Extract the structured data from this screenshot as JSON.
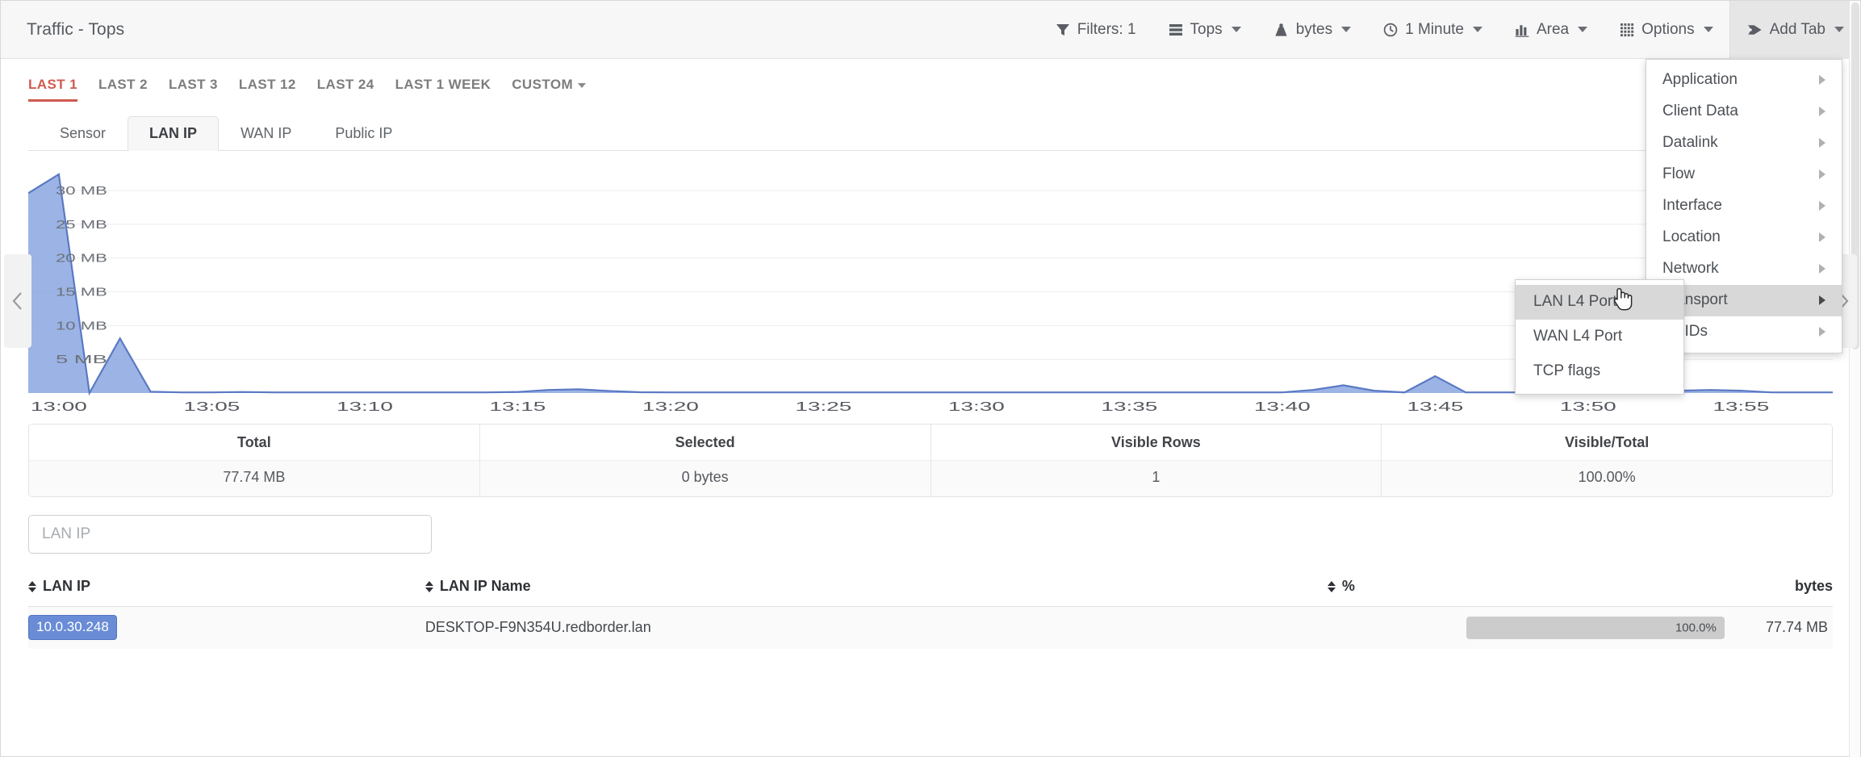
{
  "header": {
    "title": "Traffic - Tops",
    "tools": [
      {
        "id": "filters",
        "icon": "filter-icon",
        "label": "Filters: 1",
        "caret": false
      },
      {
        "id": "tops",
        "icon": "list-icon",
        "label": "Tops",
        "caret": true
      },
      {
        "id": "bytes",
        "icon": "weight-icon",
        "label": "bytes",
        "caret": true
      },
      {
        "id": "interval",
        "icon": "clock-icon",
        "label": "1 Minute",
        "caret": true
      },
      {
        "id": "charttype",
        "icon": "bar-chart-icon",
        "label": "Area",
        "caret": true
      },
      {
        "id": "options",
        "icon": "grid-icon",
        "label": "Options",
        "caret": true
      },
      {
        "id": "addtab",
        "icon": "tag-icon",
        "label": "Add Tab",
        "caret": true,
        "active": true
      }
    ]
  },
  "periods": [
    {
      "label": "LAST 1",
      "selected": true
    },
    {
      "label": "LAST 2",
      "selected": false
    },
    {
      "label": "LAST 3",
      "selected": false
    },
    {
      "label": "LAST 12",
      "selected": false
    },
    {
      "label": "LAST 24",
      "selected": false
    },
    {
      "label": "LAST 1 WEEK",
      "selected": false
    },
    {
      "label": "CUSTOM",
      "selected": false,
      "caret": true
    }
  ],
  "subtabs": [
    {
      "label": "Sensor",
      "selected": false
    },
    {
      "label": "LAN IP",
      "selected": true
    },
    {
      "label": "WAN IP",
      "selected": false
    },
    {
      "label": "Public IP",
      "selected": false
    }
  ],
  "chart_data": {
    "type": "area",
    "title": "",
    "xlabel": "",
    "ylabel": "",
    "series_name": "10.0.30.248",
    "color": "#8aa7e0",
    "line_color": "#5b79c4",
    "grid": true,
    "legend": "none",
    "ylim": [
      0,
      33
    ],
    "ytick_labels": [
      "5 MB",
      "10 MB",
      "15 MB",
      "20 MB",
      "25 MB",
      "30 MB"
    ],
    "ytick_values": [
      5,
      10,
      15,
      20,
      25,
      30
    ],
    "xtick_labels": [
      "13:00",
      "13:05",
      "13:10",
      "13:15",
      "13:20",
      "13:25",
      "13:30",
      "13:35",
      "13:40",
      "13:45",
      "13:50",
      "13:55"
    ],
    "x": [
      "12:59",
      "13:00",
      "13:01",
      "13:02",
      "13:03",
      "13:04",
      "13:05",
      "13:06",
      "13:07",
      "13:08",
      "13:09",
      "13:10",
      "13:11",
      "13:12",
      "13:13",
      "13:14",
      "13:15",
      "13:16",
      "13:17",
      "13:18",
      "13:19",
      "13:20",
      "13:21",
      "13:22",
      "13:23",
      "13:24",
      "13:25",
      "13:26",
      "13:27",
      "13:28",
      "13:29",
      "13:30",
      "13:31",
      "13:32",
      "13:33",
      "13:34",
      "13:35",
      "13:36",
      "13:37",
      "13:38",
      "13:39",
      "13:40",
      "13:41",
      "13:42",
      "13:43",
      "13:44",
      "13:45",
      "13:46",
      "13:47",
      "13:48",
      "13:49",
      "13:50",
      "13:51",
      "13:52",
      "13:53",
      "13:54",
      "13:55",
      "13:56",
      "13:57",
      "13:58"
    ],
    "values": [
      29.6,
      32.4,
      0.0,
      8.1,
      0.2,
      0.1,
      0.1,
      0.15,
      0.1,
      0.1,
      0.1,
      0.1,
      0.1,
      0.1,
      0.1,
      0.1,
      0.15,
      0.45,
      0.55,
      0.3,
      0.12,
      0.1,
      0.1,
      0.1,
      0.1,
      0.1,
      0.1,
      0.1,
      0.1,
      0.1,
      0.1,
      0.1,
      0.1,
      0.1,
      0.1,
      0.1,
      0.1,
      0.1,
      0.1,
      0.1,
      0.1,
      0.1,
      0.45,
      1.15,
      0.35,
      0.1,
      2.5,
      0.1,
      0.1,
      0.1,
      0.1,
      0.1,
      0.1,
      0.1,
      0.35,
      0.45,
      0.35,
      0.1,
      0.1,
      0.1
    ]
  },
  "summary": {
    "cells": [
      {
        "label": "Total",
        "value": "77.74 MB"
      },
      {
        "label": "Selected",
        "value": "0 bytes"
      },
      {
        "label": "Visible Rows",
        "value": "1"
      },
      {
        "label": "Visible/Total",
        "value": "100.00%"
      }
    ]
  },
  "search": {
    "placeholder": "LAN IP",
    "value": ""
  },
  "table": {
    "columns": [
      {
        "label": "LAN IP",
        "sortable": true,
        "align": "left"
      },
      {
        "label": "LAN IP Name",
        "sortable": true,
        "align": "left"
      },
      {
        "label": "%",
        "sortable": true,
        "align": "left"
      },
      {
        "label": "bytes",
        "sortable": false,
        "align": "right"
      }
    ],
    "rows": [
      {
        "lan_ip": "10.0.30.248",
        "lan_ip_name": "DESKTOP-F9N354U.redborder.lan",
        "percent_label": "100.0%",
        "percent_value": 100,
        "bytes": "77.74 MB"
      }
    ]
  },
  "menus": {
    "add_tab": {
      "items": [
        {
          "label": "Application",
          "highlighted": false
        },
        {
          "label": "Client Data",
          "highlighted": false
        },
        {
          "label": "Datalink",
          "highlighted": false
        },
        {
          "label": "Flow",
          "highlighted": false
        },
        {
          "label": "Interface",
          "highlighted": false
        },
        {
          "label": "Location",
          "highlighted": false
        },
        {
          "label": "Network",
          "highlighted": false
        },
        {
          "label": "Transport",
          "highlighted": true
        },
        {
          "label": "UUIDs",
          "highlighted": false
        }
      ]
    },
    "transport_submenu": {
      "items": [
        {
          "label": "LAN L4 Port",
          "highlighted": true
        },
        {
          "label": "WAN L4 Port",
          "highlighted": false
        },
        {
          "label": "TCP flags",
          "highlighted": false
        }
      ]
    }
  }
}
